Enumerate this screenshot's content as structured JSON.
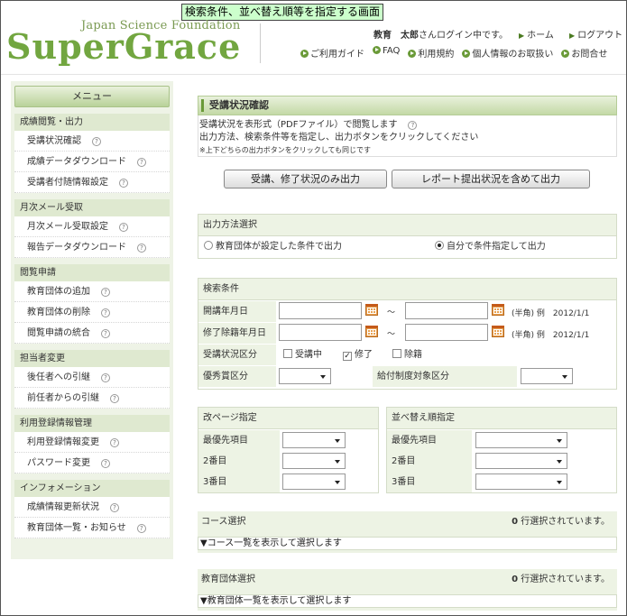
{
  "caption": "検索条件、並べ替え順等を指定する画面",
  "brand": {
    "small": "Japan Science Foundation",
    "big": "SuperGrace"
  },
  "header": {
    "user": "教育　太郎",
    "login_suffix": "さんログイン中です。",
    "home": "ホーム",
    "logout": "ログアウト",
    "subnav": [
      "ご利用ガイド",
      "FAQ",
      "利用規約",
      "個人情報のお取扱い",
      "お問合せ"
    ]
  },
  "sidebar": {
    "menu_title": "メニュー",
    "groups": [
      {
        "title": "成績閲覧・出力",
        "items": [
          "受講状況確認",
          "成績データダウンロード",
          "受講者付随情報設定"
        ]
      },
      {
        "title": "月次メール受取",
        "items": [
          "月次メール受取設定",
          "報告データダウンロード"
        ]
      },
      {
        "title": "閲覧申請",
        "items": [
          "教育団体の追加",
          "教育団体の削除",
          "閲覧申請の統合"
        ]
      },
      {
        "title": "担当者変更",
        "items": [
          "後任者への引継",
          "前任者からの引継"
        ]
      },
      {
        "title": "利用登録情報管理",
        "items": [
          "利用登録情報変更",
          "パスワード変更"
        ]
      },
      {
        "title": "インフォメーション",
        "items": [
          "成績情報更新状況",
          "教育団体一覧・お知らせ"
        ]
      }
    ]
  },
  "main": {
    "title": "受講状況確認",
    "desc1": "受講状況を表形式（PDFファイル）で閲覧します",
    "desc2": "出力方法、検索条件等を指定し、出力ボタンをクリックしてください",
    "desc3": "※上下どちらの出力ボタンをクリックしても同じです",
    "btn_only": "受講、修了状況のみ出力",
    "btn_report": "レポート提出状況を含めて出力",
    "output_method": {
      "title": "出力方法選択",
      "opt1": "教育団体が設定した条件で出力",
      "opt2": "自分で条件指定して出力",
      "selected": "自分で条件指定して出力"
    },
    "search": {
      "title": "検索条件",
      "start_label": "開講年月日",
      "end_label": "修了除籍年月日",
      "tilde": "～",
      "hint_half": "(半角)",
      "hint_example": "例　2012/1/1",
      "status_label": "受講状況区分",
      "status_opts": [
        {
          "label": "受講中",
          "checked": false
        },
        {
          "label": "修了",
          "checked": true
        },
        {
          "label": "除籍",
          "checked": false
        }
      ],
      "excellence_label": "優秀賞区分",
      "benefit_label": "給付制度対象区分",
      "check_mark": "✓"
    },
    "pagebreak": {
      "title": "改ページ指定",
      "rows": [
        "最優先項目",
        "2番目",
        "3番目"
      ]
    },
    "sort": {
      "title": "並べ替え順指定",
      "rows": [
        "最優先項目",
        "2番目",
        "3番目"
      ]
    },
    "course": {
      "title": "コース選択",
      "count": "0",
      "count_suffix": "行選択されています。",
      "link": "▼コース一覧を表示して選択します"
    },
    "org": {
      "title": "教育団体選択",
      "count": "0",
      "count_suffix": "行選択されています。",
      "link": "▼教育団体一覧を表示して選択します"
    }
  }
}
